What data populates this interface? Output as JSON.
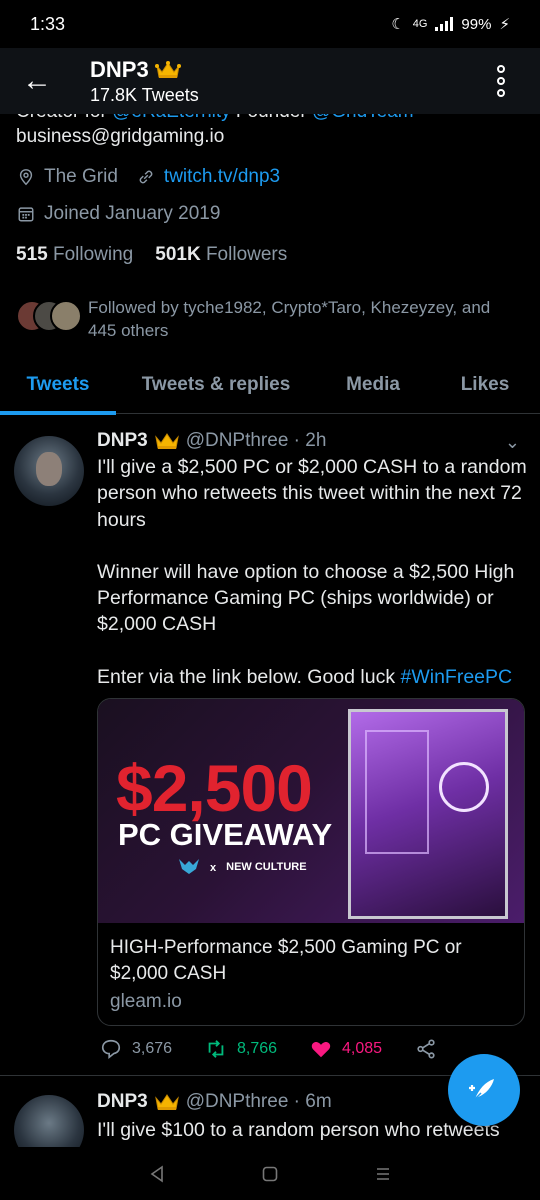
{
  "status": {
    "time": "1:33",
    "network": "4G",
    "battery": "99%"
  },
  "header": {
    "name": "DNP3",
    "tweet_count": "17.8K Tweets"
  },
  "bio": {
    "cut_prefix": "Creator for ",
    "cut_link1": "@eRaEternity",
    "cut_middle": " Founder ",
    "cut_link2": "@GridTeam",
    "email": "business@gridgaming.io"
  },
  "meta": {
    "location": "The Grid",
    "website": "twitch.tv/dnp3",
    "joined": "Joined January 2019"
  },
  "stats": {
    "following_count": "515",
    "following_label": "Following",
    "followers_count": "501K",
    "followers_label": "Followers"
  },
  "followed_by": "Followed by tyche1982, Crypto*Taro, Khezeyzey, and 445 others",
  "tabs": [
    {
      "label": "Tweets"
    },
    {
      "label": "Tweets & replies"
    },
    {
      "label": "Media"
    },
    {
      "label": "Likes"
    }
  ],
  "tweet": {
    "name": "DNP3",
    "handle_time": "@DNPthree · 2h",
    "p1": "I'll give a $2,500 PC or $2,000 CASH to a random person who retweets this tweet within the next 72 hours",
    "p2": "Winner will have option to choose a $2,500 High Performance Gaming PC (ships worldwide) or $2,000 CASH",
    "p3_text": "Enter via the link below. Good luck ",
    "p3_hashtag": "#WinFreePC",
    "card": {
      "poster_amount": "$2,500",
      "poster_title": "PC GIVEAWAY",
      "poster_x": "x",
      "poster_brand": "NEW CULTURE",
      "title": "HIGH-Performance $2,500 Gaming PC or $2,000 CASH",
      "domain": "gleam.io"
    },
    "replies": "3,676",
    "retweets": "8,766",
    "likes": "4,085"
  },
  "tweet2": {
    "name": "DNP3",
    "handle_time": "@DNPthree · 6m",
    "text": "I'll give $100 to a random person who retweets"
  },
  "colors": {
    "accent": "#1d9bf0",
    "retweet": "#00ba7c",
    "like": "#f91880",
    "background": "#000000"
  }
}
